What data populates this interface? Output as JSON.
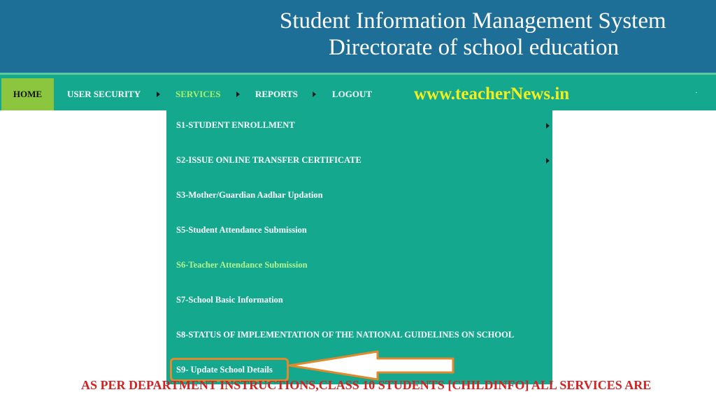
{
  "header": {
    "title_line1": "Student Information Management System",
    "title_line2": "Directorate of school education"
  },
  "nav": {
    "home": "HOME",
    "user_security": "USER SECURITY",
    "services": "SERVICES",
    "reports": "REPORTS",
    "logout": "LOGOUT"
  },
  "watermark": "www.teacherNews.in",
  "services_menu": {
    "items": [
      {
        "label": "S1-STUDENT ENROLLMENT",
        "has_submenu": true
      },
      {
        "label": "S2-ISSUE ONLINE TRANSFER CERTIFICATE",
        "has_submenu": true
      },
      {
        "label": "S3-Mother/Guardian Aadhar Updation",
        "has_submenu": false
      },
      {
        "label": "S5-Student Attendance Submission",
        "has_submenu": false
      },
      {
        "label": "S6-Teacher Attendance Submission",
        "has_submenu": false,
        "highlighted": true
      },
      {
        "label": "S7-School Basic Information",
        "has_submenu": false
      },
      {
        "label": "S8-STATUS OF IMPLEMENTATION OF THE NATIONAL GUIDELINES ON SCHOOL",
        "has_submenu": false
      },
      {
        "label": "S9- Update School Details",
        "has_submenu": false,
        "annotated": true
      }
    ]
  },
  "notice": "AS PER DEPARTMENT INSTRUCTIONS,CLASS 10 STUDENTS [CHILDINFO] ALL SERVICES ARE",
  "colors": {
    "header_bg": "#1d6f98",
    "nav_bg": "#14a88f",
    "home_bg": "#8cc63f",
    "active_nav": "#a6f06a",
    "watermark": "#f2ef1e",
    "notice": "#d62020",
    "annotation": "#e08a2c"
  }
}
